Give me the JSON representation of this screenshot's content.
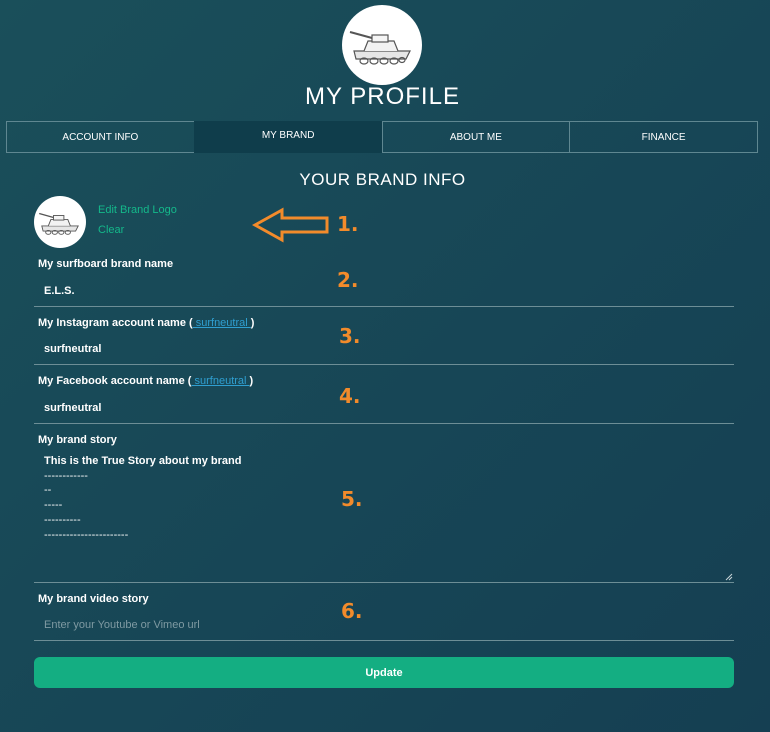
{
  "header": {
    "title": "MY PROFILE",
    "avatar_icon": "tank-icon"
  },
  "tabs": [
    {
      "label": "ACCOUNT INFO",
      "active": false
    },
    {
      "label": "MY BRAND",
      "active": true
    },
    {
      "label": "ABOUT ME",
      "active": false
    },
    {
      "label": "FINANCE",
      "active": false
    }
  ],
  "section": {
    "title": "YOUR BRAND INFO"
  },
  "logo": {
    "edit_label": "Edit Brand Logo",
    "clear_label": "Clear",
    "icon": "tank-icon"
  },
  "annotations": [
    "1.",
    "2.",
    "3.",
    "4.",
    "5.",
    "6."
  ],
  "fields": {
    "brand_name": {
      "label": "My surfboard brand name",
      "value": "E.L.S."
    },
    "instagram": {
      "label": "My Instagram account name",
      "label_open": " (",
      "link": " surfneutral ",
      "label_close": ")",
      "value": "surfneutral"
    },
    "facebook": {
      "label": "My Facebook account name",
      "label_open": " (",
      "link": " surfneutral ",
      "label_close": ")",
      "value": "surfneutral"
    },
    "story": {
      "label": "My brand story",
      "first_line": "This is the True Story about my brand",
      "rest": "\n------------\n--\n-----\n----------\n-----------------------"
    },
    "video": {
      "label": "My brand video story",
      "placeholder": "Enter your Youtube or Vimeo url"
    }
  },
  "update_label": "Update",
  "colors": {
    "accent_green": "#14ae82",
    "link_blue": "#2f9fd1",
    "annotation_orange": "#f28b2b",
    "background": "#174656"
  }
}
